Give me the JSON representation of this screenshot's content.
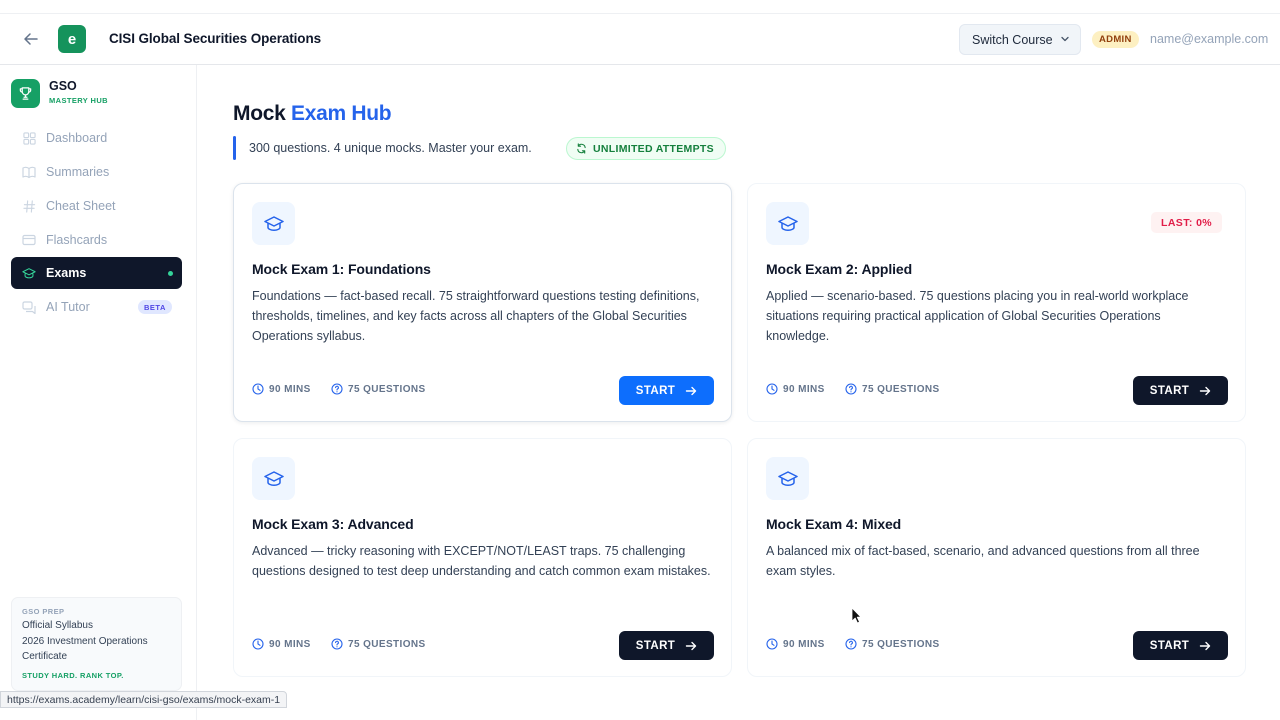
{
  "header": {
    "app_title": "CISI Global Securities Operations",
    "logo_letter": "e",
    "switch_course_label": "Switch Course",
    "role_badge": "ADMIN",
    "user_email": "name@example.com"
  },
  "sidebar": {
    "brand_name": "GSO",
    "brand_sub": "MASTERY HUB",
    "items": [
      {
        "label": "Dashboard",
        "icon": "grid-icon"
      },
      {
        "label": "Summaries",
        "icon": "book-icon"
      },
      {
        "label": "Cheat Sheet",
        "icon": "hash-icon"
      },
      {
        "label": "Flashcards",
        "icon": "card-icon"
      },
      {
        "label": "Exams",
        "icon": "graduation-cap-icon",
        "active": true
      },
      {
        "label": "AI Tutor",
        "icon": "chat-icon",
        "badge": "BETA"
      }
    ],
    "prep_card": {
      "kicker": "GSO PREP",
      "line1": "Official Syllabus",
      "line2": "2026 Investment Operations",
      "line3": "Certificate",
      "footer": "STUDY HARD. RANK TOP."
    }
  },
  "status_url": "https://exams.academy/learn/cisi-gso/exams/mock-exam-1",
  "main": {
    "title_part1": "Mock",
    "title_part2": "Exam Hub",
    "subtitle": "300 questions. 4 unique mocks. Master your exam.",
    "unlimited_badge": "UNLIMITED ATTEMPTS",
    "cards": [
      {
        "title": "Mock Exam 1: Foundations",
        "description": "Foundations — fact-based recall. 75 straightforward questions testing definitions, thresholds, timelines, and key facts across all chapters of the Global Securities Operations syllabus.",
        "duration": "90 MINS",
        "questions": "75 QUESTIONS",
        "button": "START"
      },
      {
        "title": "Mock Exam 2: Applied",
        "description": "Applied — scenario-based. 75 questions placing you in real-world workplace situations requiring practical application of Global Securities Operations knowledge.",
        "duration": "90 MINS",
        "questions": "75 QUESTIONS",
        "button": "START",
        "last_badge": "LAST: 0%"
      },
      {
        "title": "Mock Exam 3: Advanced",
        "description": "Advanced — tricky reasoning with EXCEPT/NOT/LEAST traps. 75 challenging questions designed to test deep understanding and catch common exam mistakes.",
        "duration": "90 MINS",
        "questions": "75 QUESTIONS",
        "button": "START"
      },
      {
        "title": "Mock Exam 4: Mixed",
        "description": "A balanced mix of fact-based, scenario, and advanced questions from all three exam styles.",
        "duration": "90 MINS",
        "questions": "75 QUESTIONS",
        "button": "START"
      }
    ]
  },
  "colors": {
    "accent_blue": "#2563eb",
    "primary_button": "#0d6efd",
    "dark": "#0f172a",
    "brand_green": "#16a065",
    "danger": "#e11d48"
  }
}
